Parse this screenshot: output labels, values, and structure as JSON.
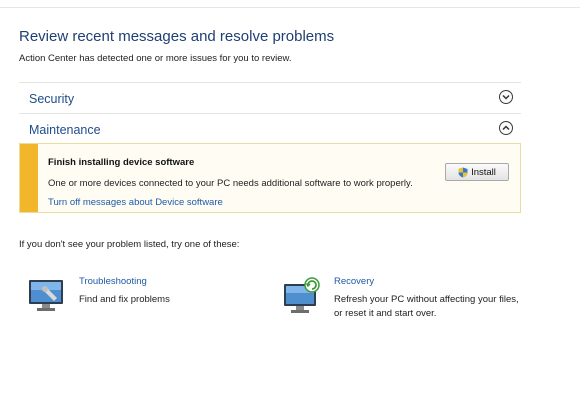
{
  "header": {
    "title": "Review recent messages and resolve problems",
    "subtitle": "Action Center has detected one or more issues for you to review."
  },
  "sections": {
    "security": {
      "label": "Security",
      "icon": "chevron-down-icon"
    },
    "maintenance": {
      "label": "Maintenance",
      "icon": "chevron-up-icon"
    }
  },
  "alert": {
    "title": "Finish installing device software",
    "description": "One or more devices connected to your PC needs additional software to work properly.",
    "link": "Turn off messages about Device software",
    "button_label": "Install",
    "bar_color": "#f1b62a"
  },
  "hint": "If you don't see your problem listed, try one of these:",
  "tools": {
    "troubleshooting": {
      "title": "Troubleshooting",
      "description": "Find and fix problems",
      "icon": "troubleshooting-icon"
    },
    "recovery": {
      "title": "Recovery",
      "description": "Refresh your PC without affecting your files, or reset it and start over.",
      "icon": "recovery-icon"
    }
  }
}
